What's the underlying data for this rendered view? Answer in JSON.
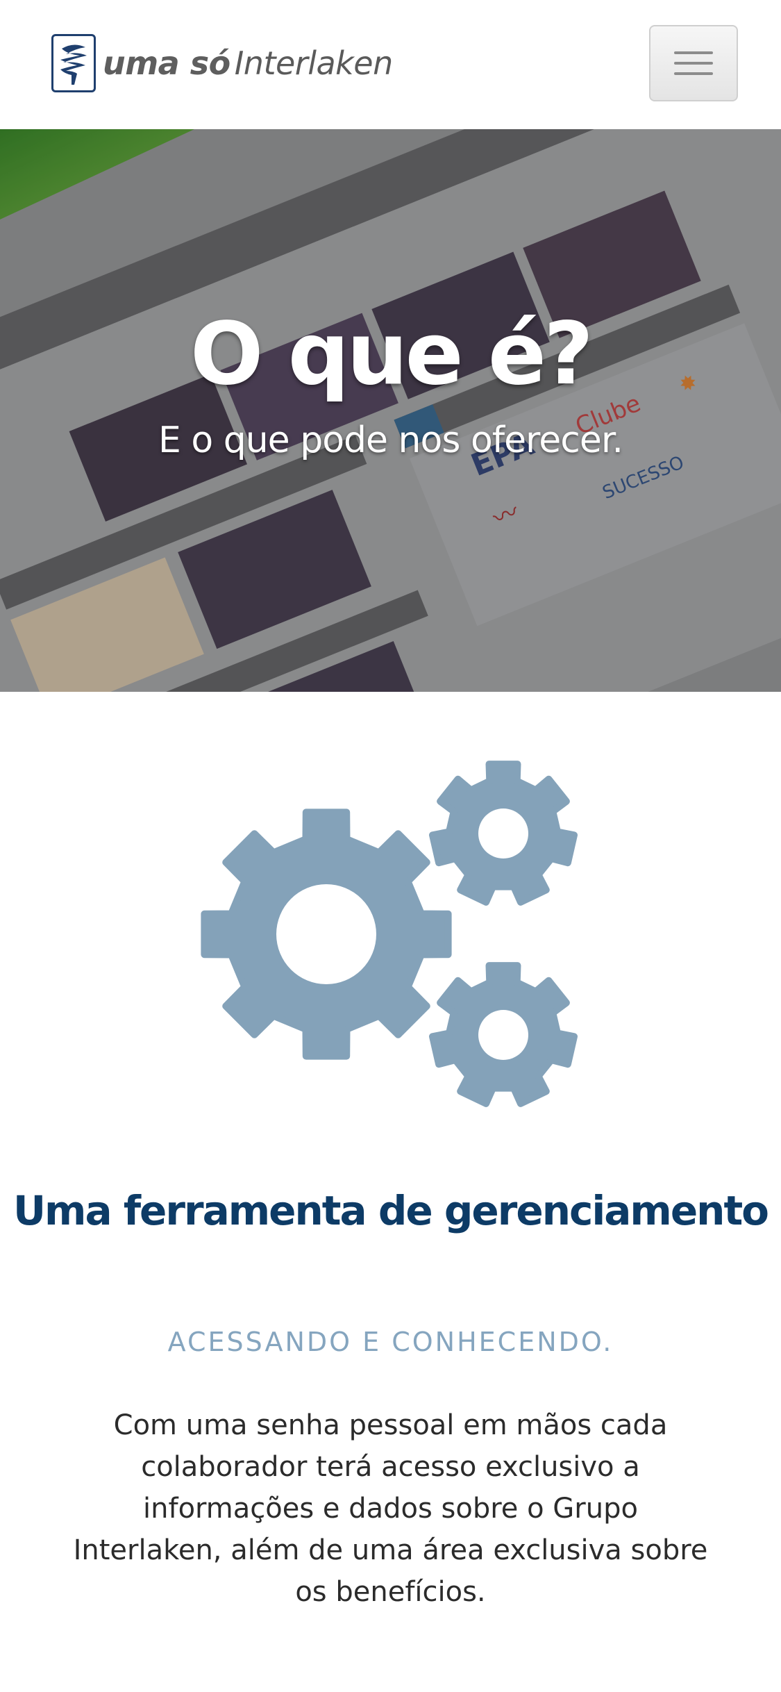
{
  "header": {
    "logo": {
      "prefix": "uma só",
      "brand": "Interlaken"
    },
    "menu_icon": "hamburger-icon"
  },
  "hero": {
    "title": "O que é?",
    "subtitle": "E o que pode nos oferecer."
  },
  "section": {
    "icon": "gears-icon",
    "icon_color": "#84a2b9",
    "title": "Uma ferramenta de gerenciamento",
    "subtitle": "ACESSANDO E CONHECENDO.",
    "body": "Com uma senha pessoal em mãos cada colaborador terá acesso exclusivo a informações e dados sobre o Grupo Interlaken, além de uma área exclusiva sobre os benefícios."
  },
  "colors": {
    "title": "#0d3b66",
    "subtitle": "#85a5bf",
    "text": "#2b2b2b"
  }
}
